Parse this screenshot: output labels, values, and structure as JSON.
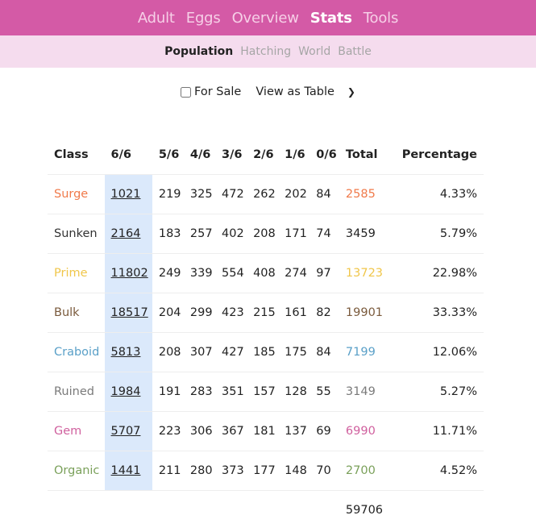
{
  "topnav": {
    "items": [
      "Adult",
      "Eggs",
      "Overview",
      "Stats",
      "Tools"
    ],
    "active": "Stats"
  },
  "subnav": {
    "items": [
      "Population",
      "Hatching",
      "World",
      "Battle"
    ],
    "active": "Population"
  },
  "controls": {
    "for_sale_label": "For Sale",
    "for_sale_checked": false,
    "view_select_value": "View as Table"
  },
  "table": {
    "headers": [
      "Class",
      "6/6",
      "5/6",
      "4/6",
      "3/6",
      "2/6",
      "1/6",
      "0/6",
      "Total",
      "Percentage"
    ],
    "rows": [
      {
        "cls": "Surge",
        "color": "#f07a4a",
        "v66": "1021",
        "v56": "219",
        "v46": "325",
        "v36": "472",
        "v26": "262",
        "v16": "202",
        "v06": "84",
        "total": "2585",
        "pct": "4.33%"
      },
      {
        "cls": "Sunken",
        "color": "#333333",
        "v66": "2164",
        "v56": "183",
        "v46": "257",
        "v36": "402",
        "v26": "208",
        "v16": "171",
        "v06": "74",
        "total": "3459",
        "pct": "5.79%"
      },
      {
        "cls": "Prime",
        "color": "#f0c64a",
        "v66": "11802",
        "v56": "249",
        "v46": "339",
        "v36": "554",
        "v26": "408",
        "v16": "274",
        "v06": "97",
        "total": "13723",
        "pct": "22.98%"
      },
      {
        "cls": "Bulk",
        "color": "#7a5a3c",
        "v66": "18517",
        "v56": "204",
        "v46": "299",
        "v36": "423",
        "v26": "215",
        "v16": "161",
        "v06": "82",
        "total": "19901",
        "pct": "33.33%"
      },
      {
        "cls": "Craboid",
        "color": "#5aa0c8",
        "v66": "5813",
        "v56": "208",
        "v46": "307",
        "v36": "427",
        "v26": "185",
        "v16": "175",
        "v06": "84",
        "total": "7199",
        "pct": "12.06%"
      },
      {
        "cls": "Ruined",
        "color": "#7a7a7a",
        "v66": "1984",
        "v56": "191",
        "v46": "283",
        "v36": "351",
        "v26": "157",
        "v16": "128",
        "v06": "55",
        "total": "3149",
        "pct": "5.27%"
      },
      {
        "cls": "Gem",
        "color": "#d0609e",
        "v66": "5707",
        "v56": "223",
        "v46": "306",
        "v36": "367",
        "v26": "181",
        "v16": "137",
        "v06": "69",
        "total": "6990",
        "pct": "11.71%"
      },
      {
        "cls": "Organic",
        "color": "#7aa05a",
        "v66": "1441",
        "v56": "211",
        "v46": "280",
        "v36": "373",
        "v26": "177",
        "v16": "148",
        "v06": "70",
        "total": "2700",
        "pct": "4.52%"
      }
    ],
    "grand_total": "59706"
  },
  "colors": {
    "topnav_bg": "#d45aa6",
    "subnav_bg": "#f5dcee",
    "highlight_col": "#dbe9fb"
  }
}
